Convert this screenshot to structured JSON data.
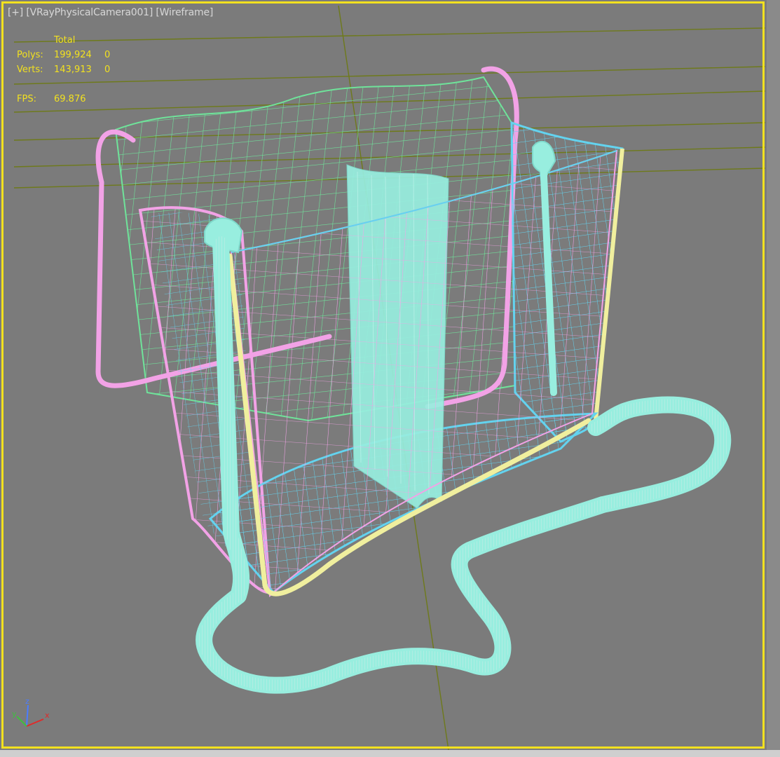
{
  "viewport": {
    "labels": {
      "menu": "[+]",
      "camera": "[VRayPhysicalCamera001]",
      "shading": "[Wireframe]"
    },
    "stats": {
      "header": "Total",
      "polys_label": "Polys:",
      "polys_total": "199,924",
      "polys_sel": "0",
      "verts_label": "Verts:",
      "verts_total": "143,913",
      "verts_sel": "0",
      "fps_label": "FPS:",
      "fps_value": "69.876"
    },
    "axis_gizmo": {
      "x": "x",
      "y": "y",
      "z": "z"
    },
    "colors": {
      "background": "#7b7b7b",
      "active_border": "#f2e11f",
      "stats_text": "#f2e11f",
      "grid": "#6e7a1a",
      "wire_green": "#6fe39a",
      "wire_pink": "#f2a2e6",
      "wire_cyan": "#63d3ef",
      "wire_teal": "#98eedf",
      "wire_yellow": "#f0ef9e"
    }
  }
}
